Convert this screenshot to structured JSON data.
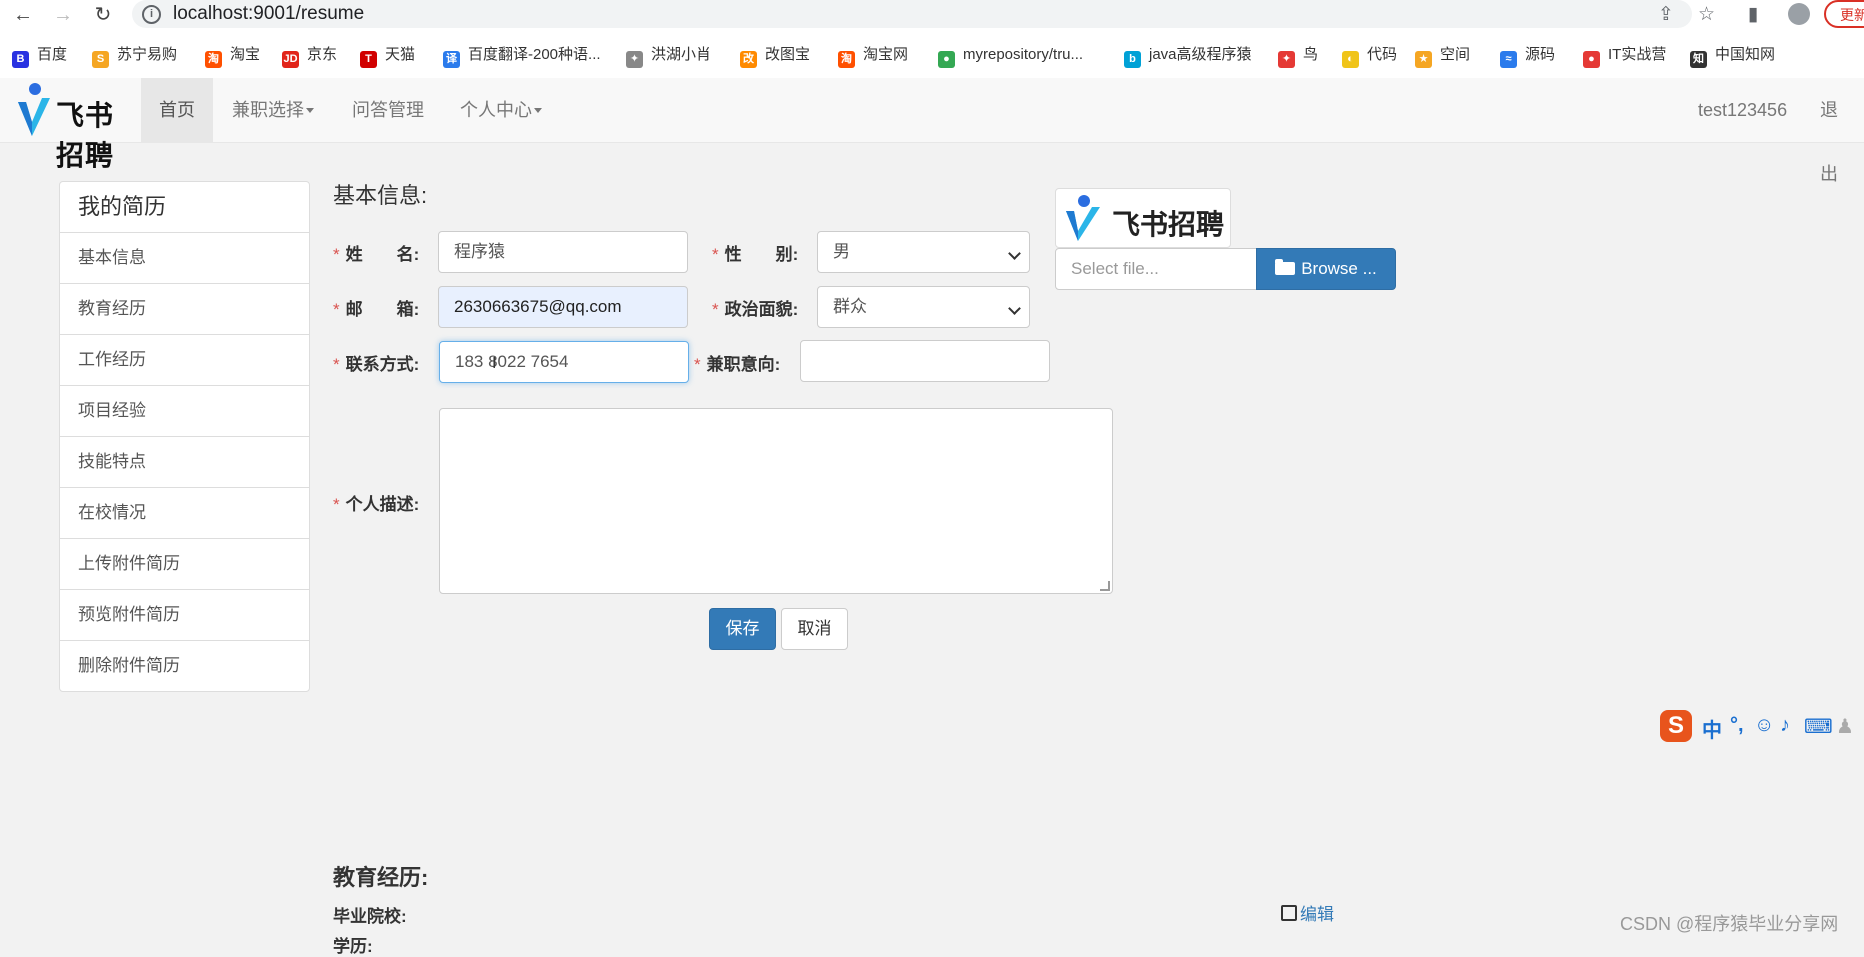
{
  "browser": {
    "url": "localhost:9001/resume",
    "update_label": "更新",
    "bookmarks": [
      {
        "label": "百度",
        "icon": "baidu-icon",
        "color": "#2932e1"
      },
      {
        "label": "苏宁易购",
        "icon": "suning-icon",
        "color": "#f5a623"
      },
      {
        "label": "淘宝",
        "icon": "taobao-icon",
        "color": "#ff5000"
      },
      {
        "label": "京东",
        "icon": "jd-icon",
        "color": "#e1251b"
      },
      {
        "label": "天猫",
        "icon": "tmall-icon",
        "color": "#d10000"
      },
      {
        "label": "百度翻译-200种语...",
        "icon": "fanyi-icon",
        "color": "#2b7bec"
      },
      {
        "label": "洪湖小肖",
        "icon": "bird-icon",
        "color": "#888888"
      },
      {
        "label": "改图宝",
        "icon": "gaitubao-icon",
        "color": "#ff8a00"
      },
      {
        "label": "淘宝网",
        "icon": "taobao-icon",
        "color": "#ff5000"
      },
      {
        "label": "myrepository/tru...",
        "icon": "chrome-icon",
        "color": "#34a853"
      },
      {
        "label": "java高级程序猿",
        "icon": "bilibili-icon",
        "color": "#00a1d6"
      },
      {
        "label": "鸟",
        "icon": "bird-red-icon",
        "color": "#e53935"
      },
      {
        "label": "代码",
        "icon": "code-icon",
        "color": "#f0c419"
      },
      {
        "label": "空间",
        "icon": "qzone-icon",
        "color": "#f5a623"
      },
      {
        "label": "源码",
        "icon": "fish-icon",
        "color": "#2b7bec"
      },
      {
        "label": "IT实战营",
        "icon": "chrome-red-icon",
        "color": "#e53935"
      },
      {
        "label": "中国知网",
        "icon": "cnki-icon",
        "color": "#333333"
      }
    ]
  },
  "navbar": {
    "brand": "飞书招聘",
    "items": [
      {
        "label": "首页",
        "active": true
      },
      {
        "label": "兼职选择",
        "dropdown": true
      },
      {
        "label": "问答管理"
      },
      {
        "label": "个人中心",
        "dropdown": true
      }
    ],
    "username": "test123456",
    "logout": "退出"
  },
  "sidebar": {
    "title": "我的简历",
    "items": [
      "基本信息",
      "教育经历",
      "工作经历",
      "项目经验",
      "技能特点",
      "在校情况",
      "上传附件简历",
      "预览附件简历",
      "删除附件简历"
    ]
  },
  "form": {
    "title": "基本信息:",
    "name_label": "姓　　名:",
    "name_value": "程序猿",
    "gender_label": "性　　别:",
    "gender_value": "男",
    "email_label": "邮　　箱:",
    "email_value": "2630663675@qq.com",
    "politics_label": "政治面貌:",
    "politics_value": "群众",
    "contact_label": "联系方式:",
    "contact_value": "183 8022 7654",
    "intent_label": "兼职意向:",
    "intent_value": "",
    "desc_label": "个人描述:",
    "desc_value": "",
    "save": "保存",
    "cancel": "取消"
  },
  "photo": {
    "brand": "飞书招聘",
    "file_placeholder": "Select file...",
    "browse": "Browse ..."
  },
  "education": {
    "title": "教育经历:",
    "school_label": "毕业院校:",
    "degree_label": "学历:",
    "edit": "编辑"
  },
  "watermark": "CSDN @程序猿毕业分享网",
  "colors": {
    "primary": "#337ab7",
    "required": "#d9534f"
  }
}
